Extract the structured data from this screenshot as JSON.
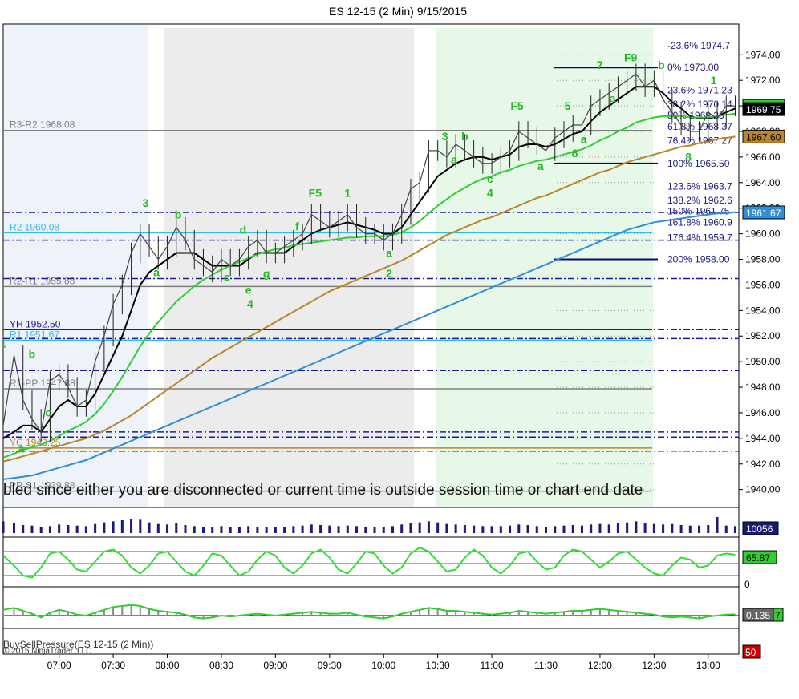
{
  "chart_data": {
    "type": "line",
    "title": "ES 12-15 (2 Min)  9/15/2015",
    "xlabel": "",
    "ylabel": "",
    "x_ticks": [
      "07:00",
      "07:30",
      "08:00",
      "08:30",
      "09:00",
      "09:30",
      "10:00",
      "10:30",
      "11:00",
      "11:30",
      "12:00",
      "12:30",
      "13:00"
    ],
    "xlim": [
      "06:29",
      "13:17"
    ],
    "ylim": [
      1938.6,
      1976.4
    ],
    "y_ticks": [
      1940,
      1942,
      1944,
      1946,
      1948,
      1950,
      1952,
      1954,
      1956,
      1958,
      1960,
      1962,
      1964,
      1966,
      1968,
      1970,
      1972,
      1974
    ],
    "price_series": {
      "name": "ES 12-15",
      "x": [
        "06:29",
        "06:35",
        "06:40",
        "06:45",
        "06:50",
        "06:55",
        "07:00",
        "07:05",
        "07:10",
        "07:15",
        "07:20",
        "07:25",
        "07:30",
        "07:35",
        "07:40",
        "07:45",
        "07:50",
        "07:55",
        "08:00",
        "08:05",
        "08:10",
        "08:15",
        "08:20",
        "08:25",
        "08:30",
        "08:35",
        "08:40",
        "08:45",
        "08:50",
        "08:55",
        "09:00",
        "09:05",
        "09:10",
        "09:15",
        "09:20",
        "09:25",
        "09:30",
        "09:35",
        "09:40",
        "09:45",
        "09:50",
        "09:55",
        "10:00",
        "10:05",
        "10:10",
        "10:15",
        "10:20",
        "10:25",
        "10:30",
        "10:35",
        "10:40",
        "10:45",
        "10:50",
        "10:55",
        "11:00",
        "11:05",
        "11:10",
        "11:15",
        "11:20",
        "11:25",
        "11:30",
        "11:35",
        "11:40",
        "11:45",
        "11:50",
        "11:55",
        "12:00",
        "12:05",
        "12:10",
        "12:15",
        "12:20",
        "12:25",
        "12:30",
        "12:35",
        "12:40",
        "12:45",
        "12:50",
        "12:55",
        "13:00",
        "13:05",
        "13:10",
        "13:15"
      ],
      "values": [
        1945.0,
        1950.5,
        1947.0,
        1945.5,
        1944.5,
        1948.5,
        1949.0,
        1948.0,
        1946.5,
        1947.0,
        1950.0,
        1952.0,
        1954.5,
        1956.0,
        1958.5,
        1960.0,
        1959.0,
        1958.0,
        1959.0,
        1960.5,
        1959.5,
        1958.0,
        1957.5,
        1957.0,
        1958.0,
        1957.5,
        1958.0,
        1959.0,
        1959.5,
        1958.5,
        1958.5,
        1959.0,
        1959.5,
        1960.0,
        1961.5,
        1961.0,
        1960.5,
        1961.0,
        1961.5,
        1960.5,
        1960.0,
        1960.0,
        1959.5,
        1960.0,
        1961.5,
        1963.5,
        1964.0,
        1966.5,
        1966.5,
        1966.0,
        1967.0,
        1966.5,
        1966.0,
        1965.5,
        1965.5,
        1966.0,
        1966.5,
        1968.0,
        1967.5,
        1967.0,
        1966.5,
        1967.5,
        1968.0,
        1968.5,
        1968.5,
        1970.0,
        1970.5,
        1971.0,
        1971.5,
        1972.0,
        1972.5,
        1971.5,
        1972.0,
        1970.5,
        1969.5,
        1968.5,
        1968.0,
        1968.0,
        1969.5,
        1969.0,
        1970.0,
        1970.0
      ]
    },
    "series": [
      {
        "color": "#000000",
        "values": [
          1944.0,
          1944.5,
          1945.0,
          1945.0,
          1944.5,
          1945.5,
          1946.5,
          1947.0,
          1946.5,
          1946.5,
          1947.5,
          1949.0,
          1950.5,
          1952.0,
          1954.0,
          1956.0,
          1957.0,
          1957.5,
          1958.0,
          1958.5,
          1958.5,
          1958.5,
          1958.0,
          1957.5,
          1957.5,
          1957.5,
          1957.5,
          1958.0,
          1958.5,
          1958.5,
          1958.5,
          1958.5,
          1959.0,
          1959.5,
          1960.0,
          1960.3,
          1960.5,
          1960.7,
          1960.9,
          1960.7,
          1960.5,
          1960.3,
          1960.0,
          1960.0,
          1960.5,
          1961.5,
          1962.5,
          1963.5,
          1964.5,
          1965.0,
          1965.5,
          1965.8,
          1966.0,
          1966.0,
          1965.8,
          1966.0,
          1966.2,
          1966.8,
          1967.0,
          1967.0,
          1966.8,
          1967.0,
          1967.4,
          1967.8,
          1968.0,
          1968.8,
          1969.5,
          1970.0,
          1970.5,
          1971.0,
          1971.5,
          1971.5,
          1971.5,
          1971.0,
          1970.3,
          1969.8,
          1969.2,
          1969.0,
          1969.0,
          1969.2,
          1969.5,
          1969.8
        ]
      },
      {
        "color": "#33cc33",
        "values": [
          1942.5,
          1942.8,
          1943.1,
          1943.3,
          1943.5,
          1943.8,
          1944.2,
          1944.6,
          1944.9,
          1945.3,
          1945.9,
          1946.7,
          1947.7,
          1948.8,
          1950.0,
          1951.2,
          1952.2,
          1953.1,
          1953.9,
          1954.7,
          1955.3,
          1955.9,
          1956.4,
          1956.8,
          1957.2,
          1957.5,
          1957.8,
          1958.1,
          1958.4,
          1958.6,
          1958.8,
          1958.9,
          1959.1,
          1959.2,
          1959.3,
          1959.4,
          1959.5,
          1959.6,
          1959.7,
          1959.7,
          1959.8,
          1959.8,
          1959.8,
          1959.9,
          1960.1,
          1960.5,
          1961.0,
          1961.6,
          1962.2,
          1962.7,
          1963.2,
          1963.6,
          1964.0,
          1964.3,
          1964.5,
          1964.8,
          1965.0,
          1965.3,
          1965.5,
          1965.7,
          1965.8,
          1966.0,
          1966.2,
          1966.4,
          1966.6,
          1966.9,
          1967.3,
          1967.6,
          1968.0,
          1968.3,
          1968.7,
          1968.9,
          1969.1,
          1969.2,
          1969.2,
          1969.2,
          1969.1,
          1969.1,
          1969.1,
          1969.2,
          1969.3,
          1969.4
        ]
      },
      {
        "color": "#b8862b",
        "values": [
          1942.2,
          1942.4,
          1942.6,
          1942.8,
          1943.0,
          1943.2,
          1943.4,
          1943.6,
          1943.8,
          1944.0,
          1944.3,
          1944.6,
          1945.0,
          1945.4,
          1945.8,
          1946.3,
          1946.8,
          1947.3,
          1947.8,
          1948.3,
          1948.8,
          1949.3,
          1949.8,
          1950.3,
          1950.7,
          1951.1,
          1951.5,
          1951.9,
          1952.3,
          1952.7,
          1953.1,
          1953.5,
          1953.9,
          1954.3,
          1954.7,
          1955.1,
          1955.5,
          1955.8,
          1956.1,
          1956.4,
          1956.7,
          1957.0,
          1957.3,
          1957.6,
          1957.9,
          1958.3,
          1958.7,
          1959.1,
          1959.5,
          1959.9,
          1960.2,
          1960.5,
          1960.8,
          1961.1,
          1961.3,
          1961.6,
          1961.9,
          1962.2,
          1962.5,
          1962.8,
          1963.0,
          1963.3,
          1963.6,
          1963.9,
          1964.2,
          1964.5,
          1964.8,
          1965.0,
          1965.3,
          1965.6,
          1965.8,
          1966.0,
          1966.2,
          1966.4,
          1966.6,
          1966.8,
          1966.9,
          1967.1,
          1967.2,
          1967.4,
          1967.5,
          1967.6
        ]
      },
      {
        "color": "#2e8fd8",
        "values": [
          1940.8,
          1940.9,
          1941.0,
          1941.1,
          1941.3,
          1941.5,
          1941.7,
          1941.9,
          1942.1,
          1942.3,
          1942.6,
          1942.9,
          1943.2,
          1943.5,
          1943.8,
          1944.1,
          1944.4,
          1944.7,
          1945.0,
          1945.3,
          1945.6,
          1945.9,
          1946.2,
          1946.5,
          1946.8,
          1947.1,
          1947.4,
          1947.7,
          1948.0,
          1948.3,
          1948.6,
          1948.9,
          1949.2,
          1949.5,
          1949.8,
          1950.1,
          1950.4,
          1950.7,
          1951.0,
          1951.3,
          1951.6,
          1951.9,
          1952.2,
          1952.5,
          1952.8,
          1953.1,
          1953.4,
          1953.7,
          1954.0,
          1954.3,
          1954.6,
          1954.9,
          1955.2,
          1955.5,
          1955.8,
          1956.1,
          1956.4,
          1956.7,
          1957.0,
          1957.3,
          1957.6,
          1957.9,
          1958.2,
          1958.5,
          1958.8,
          1959.1,
          1959.4,
          1959.7,
          1960.0,
          1960.3,
          1960.5,
          1960.7,
          1960.9,
          1961.0,
          1961.1,
          1961.2,
          1961.3,
          1961.4,
          1961.5,
          1961.6,
          1961.6,
          1961.7
        ]
      }
    ],
    "pivot_levels": [
      {
        "label": "R3-R2 1968.08",
        "value": 1968.08,
        "color": "#808080"
      },
      {
        "label": "R2 1960.08",
        "value": 1960.08,
        "color": "#33bbee"
      },
      {
        "label": "R2-R1 1955.88",
        "value": 1955.88,
        "color": "#808080"
      },
      {
        "label": "YH 1952.50",
        "value": 1952.5,
        "color": "#1a1aa0"
      },
      {
        "label": "R1 1951.67",
        "value": 1951.67,
        "color": "#33bbee"
      },
      {
        "label": "R1-PP 1947.88",
        "value": 1947.88,
        "color": "#808080"
      },
      {
        "label": "YC 1943.25",
        "value": 1943.25,
        "color": "#b8862b"
      },
      {
        "label": "PP-S1 1939.88",
        "value": 1939.88,
        "color": "#808080"
      }
    ],
    "fib_levels": [
      {
        "label": "-23.6%",
        "value": 1974.7,
        "price_text": "1974.7"
      },
      {
        "label": "0%",
        "value": 1973.0,
        "price_text": "1973.00"
      },
      {
        "label": "23.6%",
        "value": 1971.23,
        "price_text": "1971.23"
      },
      {
        "label": "38.2%",
        "value": 1970.14,
        "price_text": "1970.14"
      },
      {
        "label": "50%",
        "value": 1969.25,
        "price_text": "1969.25"
      },
      {
        "label": "61.8%",
        "value": 1968.37,
        "price_text": "1968.37"
      },
      {
        "label": "76.4%",
        "value": 1967.27,
        "price_text": "1967.27"
      },
      {
        "label": "100%",
        "value": 1965.5,
        "price_text": "1965.50"
      },
      {
        "label": "123.6%",
        "value": 1963.7,
        "price_text": "1963.7"
      },
      {
        "label": "138.2%",
        "value": 1962.6,
        "price_text": "1962.6"
      },
      {
        "label": "150%",
        "value": 1961.75,
        "price_text": "1961.75"
      },
      {
        "label": "161.8%",
        "value": 1960.9,
        "price_text": "1960.9"
      },
      {
        "label": "176.4%",
        "value": 1959.7,
        "price_text": "1959.7"
      },
      {
        "label": "200%",
        "value": 1958.0,
        "price_text": "1958.00"
      }
    ],
    "wave_labels": [
      {
        "text": "3",
        "x": "07:48",
        "y": 1962.1
      },
      {
        "text": "b",
        "x": "08:06",
        "y": 1961.2
      },
      {
        "text": "a",
        "x": "07:54",
        "y": 1956.7
      },
      {
        "text": "d",
        "x": "08:42",
        "y": 1960.0
      },
      {
        "text": "f",
        "x": "09:12",
        "y": 1960.3
      },
      {
        "text": "c",
        "x": "08:33",
        "y": 1956.3
      },
      {
        "text": "e",
        "x": "08:45",
        "y": 1955.3
      },
      {
        "text": "g",
        "x": "08:55",
        "y": 1956.6
      },
      {
        "text": "4",
        "x": "08:46",
        "y": 1954.2
      },
      {
        "text": "F5",
        "x": "09:22",
        "y": 1962.9
      },
      {
        "text": "1",
        "x": "09:40",
        "y": 1962.9
      },
      {
        "text": "a",
        "x": "10:03",
        "y": 1958.2
      },
      {
        "text": "2",
        "x": "10:03",
        "y": 1956.6
      },
      {
        "text": "3",
        "x": "10:34",
        "y": 1967.3
      },
      {
        "text": "b",
        "x": "10:45",
        "y": 1967.3
      },
      {
        "text": "a",
        "x": "10:39",
        "y": 1965.5
      },
      {
        "text": "c",
        "x": "10:59",
        "y": 1964.0
      },
      {
        "text": "4",
        "x": "10:59",
        "y": 1962.9
      },
      {
        "text": "F5",
        "x": "11:14",
        "y": 1969.7
      },
      {
        "text": "a",
        "x": "11:27",
        "y": 1965.0
      },
      {
        "text": "5",
        "x": "11:42",
        "y": 1969.7
      },
      {
        "text": "6",
        "x": "11:46",
        "y": 1966.0
      },
      {
        "text": "a",
        "x": "11:51",
        "y": 1967.1
      },
      {
        "text": "7",
        "x": "12:00",
        "y": 1972.9
      },
      {
        "text": "F9",
        "x": "12:17",
        "y": 1973.5
      },
      {
        "text": "b",
        "x": "12:34",
        "y": 1972.9
      },
      {
        "text": "a",
        "x": "12:07",
        "y": 1970.3
      },
      {
        "text": "8",
        "x": "12:49",
        "y": 1965.7
      },
      {
        "text": "1",
        "x": "13:03",
        "y": 1971.7
      },
      {
        "text": "1",
        "x": "06:29",
        "y": 1951.1
      },
      {
        "text": "b",
        "x": "06:45",
        "y": 1950.3
      },
      {
        "text": "c",
        "x": "06:54",
        "y": 1945.7
      },
      {
        "text": "a",
        "x": "06:39",
        "y": 1942.9
      }
    ],
    "price_markers": [
      {
        "text": "1970.00",
        "value": 1970.0,
        "bg": "#33cc33",
        "fg": "#000000"
      },
      {
        "text": "1969.75",
        "value": 1969.75,
        "bg": "#000000",
        "fg": "#ffffff"
      },
      {
        "text": "1967.60",
        "value": 1967.6,
        "bg": "#b8862b",
        "fg": "#000000"
      },
      {
        "text": "1961.67",
        "value": 1961.67,
        "bg": "#2e8fd8",
        "fg": "#ffffff"
      }
    ],
    "watermark": "bled since either you are disconnected or current time is outside session time or chart end date",
    "volume_panel": {
      "marker": "10056",
      "values": [
        22,
        18,
        15,
        14,
        12,
        13,
        16,
        15,
        14,
        13,
        17,
        20,
        22,
        24,
        26,
        25,
        20,
        17,
        16,
        18,
        15,
        13,
        12,
        11,
        13,
        12,
        12,
        13,
        12,
        11,
        11,
        12,
        13,
        14,
        16,
        15,
        14,
        13,
        14,
        13,
        12,
        12,
        11,
        13,
        16,
        18,
        20,
        22,
        20,
        17,
        16,
        15,
        14,
        13,
        13,
        13,
        14,
        16,
        15,
        13,
        12,
        13,
        14,
        15,
        14,
        16,
        17,
        16,
        18,
        20,
        22,
        18,
        17,
        16,
        17,
        15,
        14,
        14,
        15,
        30,
        14,
        13
      ]
    },
    "oscillator_panel": {
      "marker": "65.87",
      "zero_label": "0",
      "values": [
        70,
        45,
        20,
        15,
        40,
        75,
        80,
        60,
        35,
        30,
        55,
        80,
        85,
        70,
        40,
        25,
        45,
        75,
        80,
        55,
        30,
        20,
        45,
        75,
        70,
        45,
        20,
        30,
        60,
        80,
        70,
        40,
        25,
        45,
        75,
        85,
        65,
        35,
        25,
        50,
        80,
        75,
        45,
        25,
        40,
        75,
        90,
        80,
        55,
        30,
        35,
        65,
        85,
        70,
        40,
        25,
        45,
        75,
        80,
        55,
        35,
        40,
        70,
        85,
        80,
        60,
        40,
        55,
        75,
        80,
        60,
        40,
        25,
        20,
        45,
        65,
        60,
        40,
        45,
        70,
        75,
        72
      ]
    },
    "pressure_panel": {
      "name": "BuySellPressure(ES 12-15 (2 Min))",
      "copyright": "© 2015 NinjaTrader, LLC",
      "marker": "0.135",
      "aux_marker": "7",
      "lower_marker": "50",
      "values": [
        0.6,
        0.8,
        0.5,
        0.2,
        -0.2,
        0.3,
        0.6,
        0.4,
        0.1,
        0.0,
        0.3,
        0.6,
        0.9,
        1.0,
        1.1,
        1.0,
        0.7,
        0.5,
        0.4,
        0.3,
        0.1,
        -0.2,
        -0.3,
        -0.2,
        0.0,
        -0.1,
        0.0,
        0.1,
        0.2,
        0.1,
        0.0,
        0.1,
        0.2,
        0.3,
        0.4,
        0.3,
        0.2,
        0.2,
        0.3,
        0.1,
        -0.1,
        -0.2,
        -0.3,
        -0.1,
        0.2,
        0.4,
        0.6,
        0.8,
        0.7,
        0.5,
        0.5,
        0.4,
        0.3,
        0.2,
        0.1,
        0.2,
        0.3,
        0.5,
        0.4,
        0.3,
        0.2,
        0.3,
        0.4,
        0.5,
        0.5,
        0.6,
        0.7,
        0.6,
        0.5,
        0.4,
        0.3,
        0.2,
        0.1,
        -0.1,
        -0.2,
        -0.1,
        -0.2,
        -0.3,
        -0.1,
        0.0,
        0.1,
        0.135
      ]
    }
  }
}
